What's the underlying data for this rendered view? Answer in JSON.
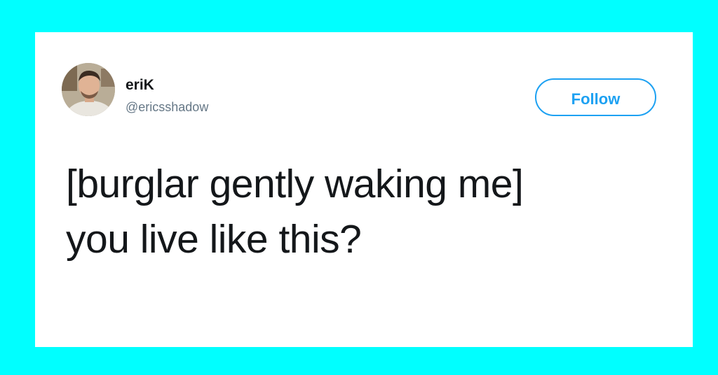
{
  "colors": {
    "background": "#00ffff",
    "card": "#ffffff",
    "accent": "#1da1f2",
    "text_primary": "#14171a",
    "text_secondary": "#657786"
  },
  "user": {
    "avatar_icon": "user-avatar-photo",
    "name": "eriK",
    "handle": "@ericsshadow"
  },
  "actions": {
    "follow_label": "Follow"
  },
  "tweet": {
    "lines": [
      "[burglar gently waking me]",
      "you live like this?"
    ]
  }
}
